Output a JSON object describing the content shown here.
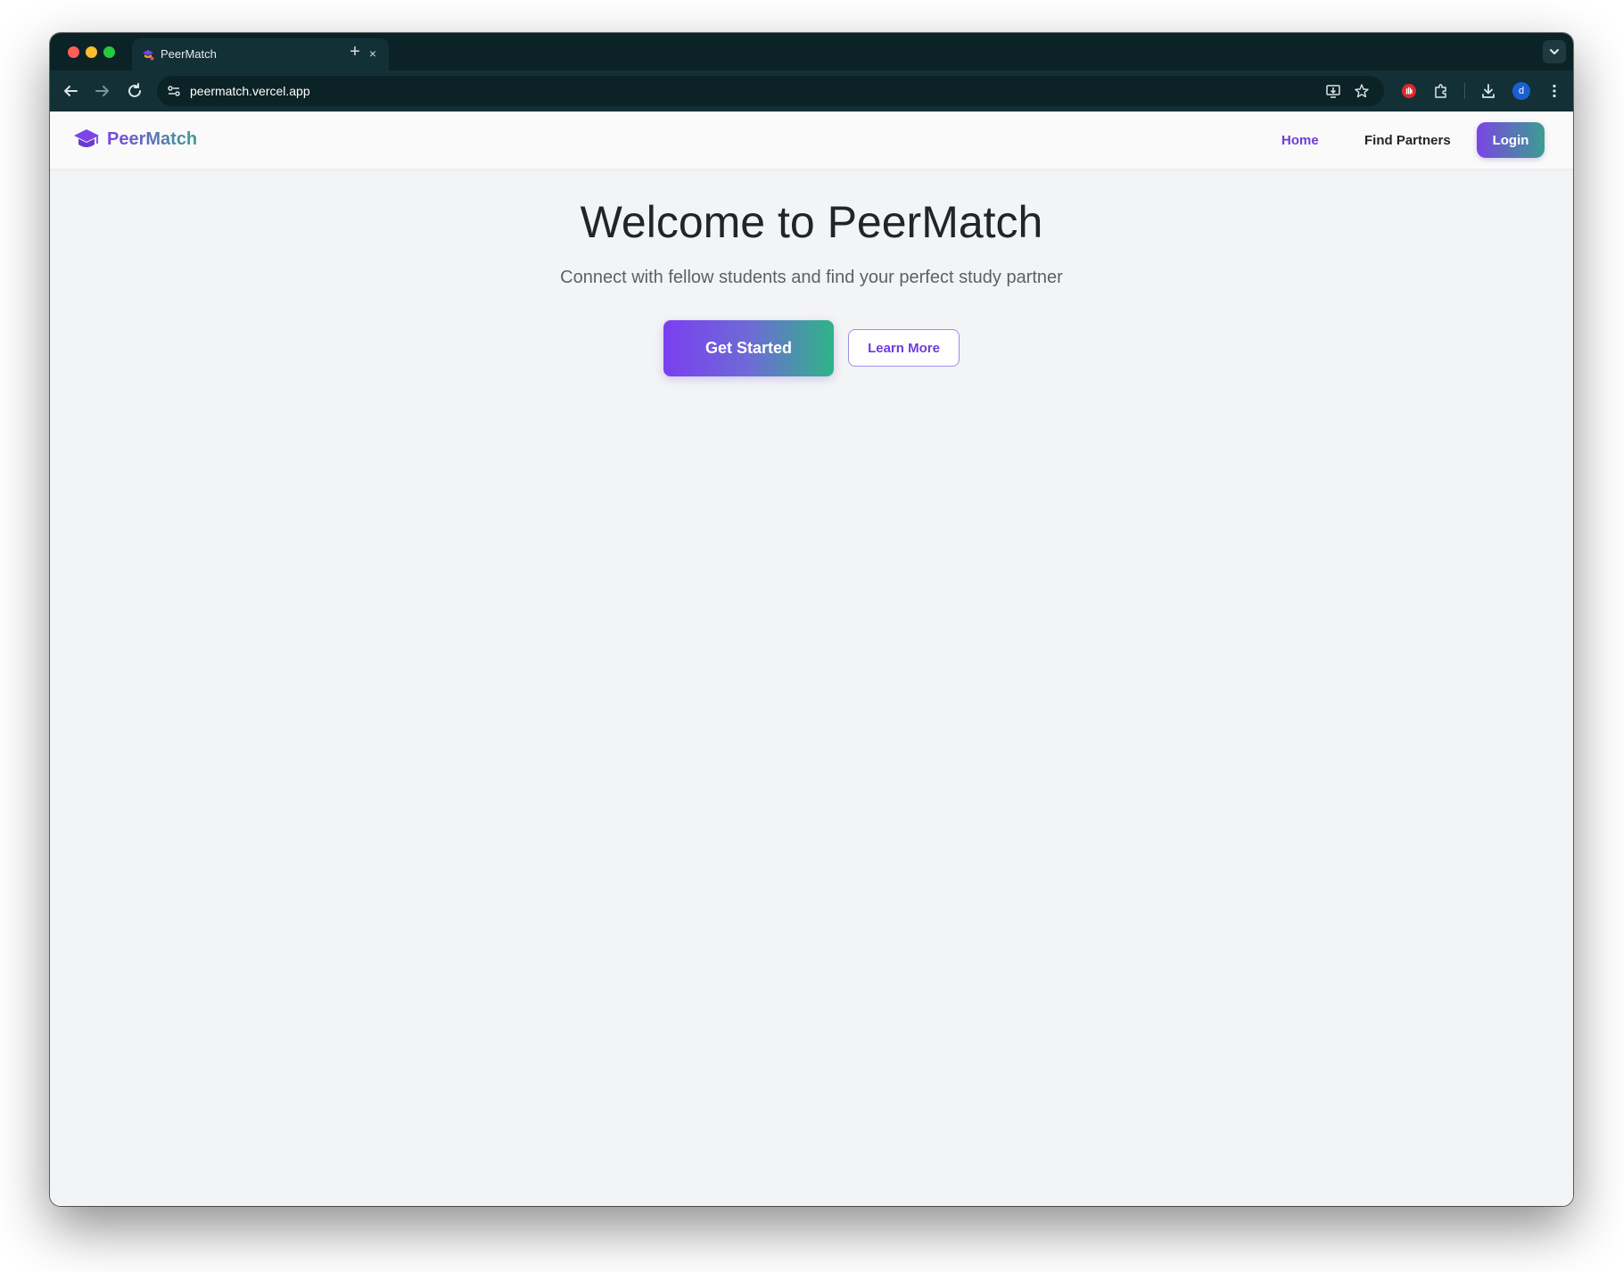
{
  "browser": {
    "tab": {
      "title": "PeerMatch",
      "close_glyph": "×",
      "favicon": "peermatch-favicon-icon"
    },
    "new_tab_glyph": "+",
    "address_bar": {
      "url": "peermatch.vercel.app"
    },
    "icons": [
      "back-arrow-icon",
      "forward-arrow-icon",
      "reload-icon",
      "site-info-icon",
      "install-app-icon",
      "bookmark-star-icon",
      "extension-red-icon",
      "extensions-puzzle-icon",
      "download-icon",
      "profile-avatar-icon",
      "more-menu-icon",
      "tab-list-chevron-icon"
    ],
    "profile_initial": "d",
    "colors": {
      "frame": "#0b2227",
      "toolbar": "#133036"
    }
  },
  "site": {
    "brand": {
      "name": "PeerMatch",
      "icon": "graduation-cap-icon"
    },
    "nav": {
      "home": "Home",
      "find_partners": "Find Partners",
      "login": "Login"
    },
    "hero": {
      "title": "Welcome to PeerMatch",
      "subtitle": "Connect with fellow students and find your perfect study partner",
      "primary_cta": "Get Started",
      "secondary_cta": "Learn More"
    },
    "colors": {
      "accent_purple": "#6d3cdb",
      "accent_teal": "#3b9e90",
      "background": "#f3f4f6"
    }
  }
}
